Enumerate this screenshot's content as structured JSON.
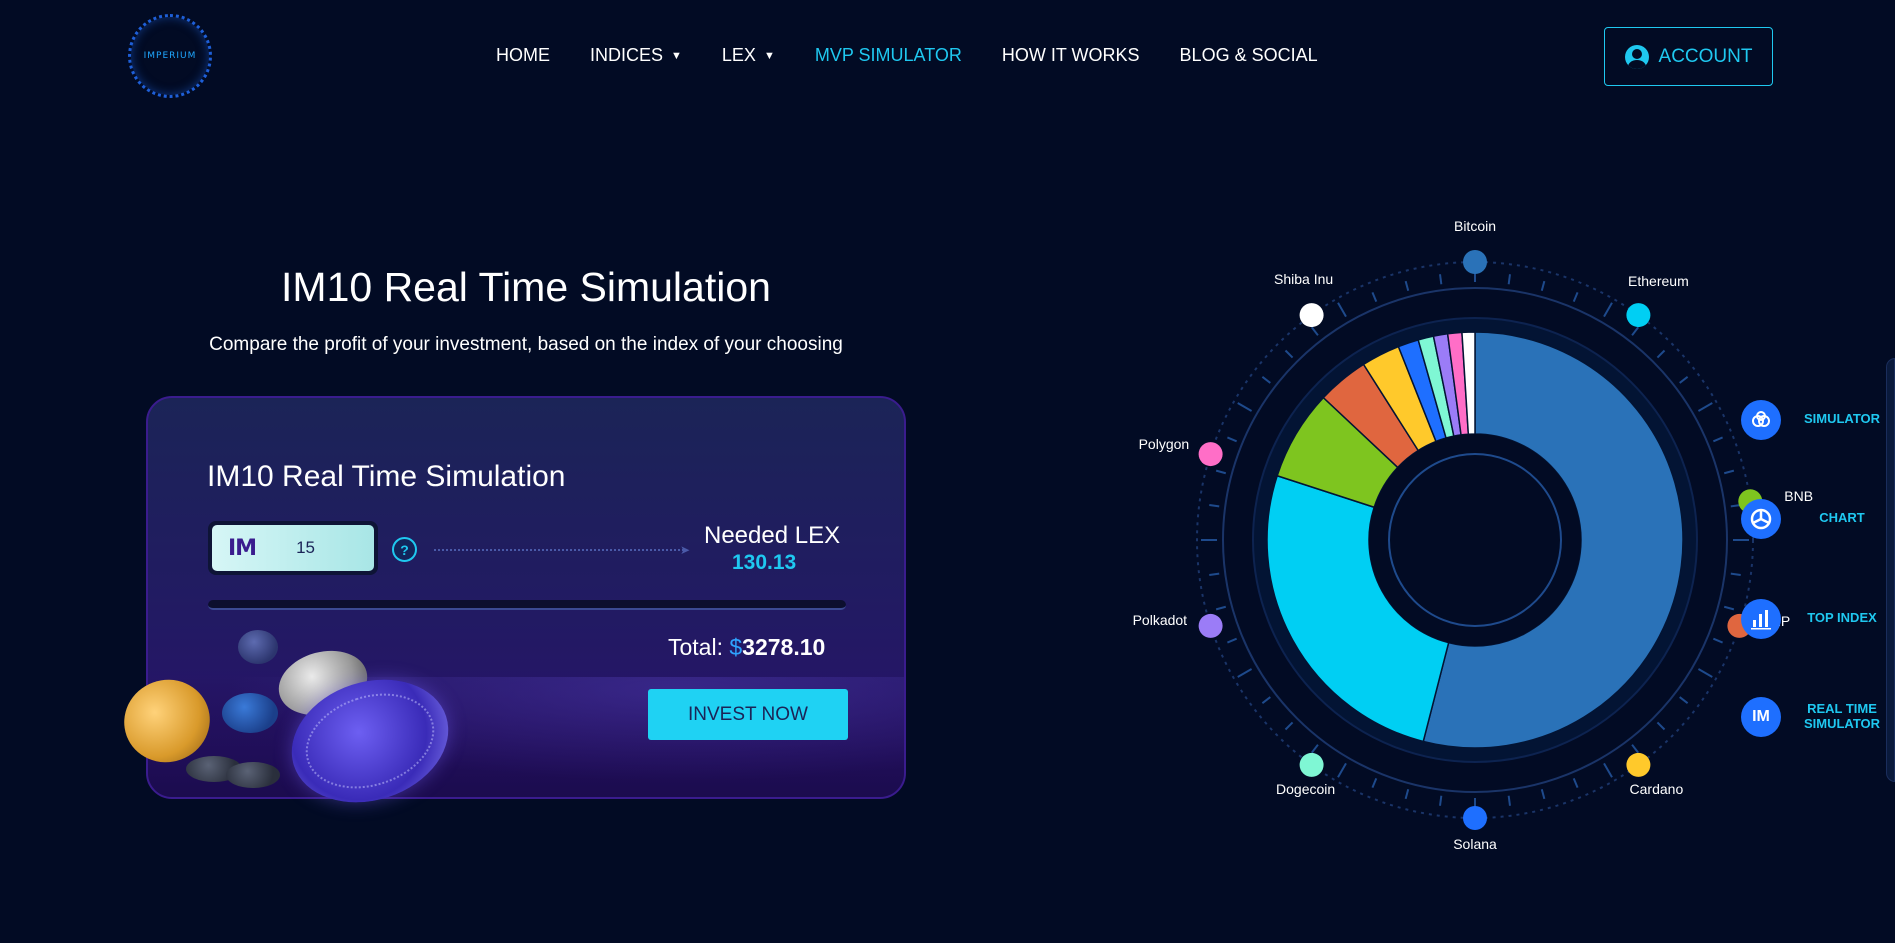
{
  "header": {
    "logo_text": "IMPERIUM",
    "nav": [
      {
        "label": "HOME",
        "dropdown": false,
        "active": false
      },
      {
        "label": "INDICES",
        "dropdown": true,
        "active": false
      },
      {
        "label": "LEX",
        "dropdown": true,
        "active": false
      },
      {
        "label": "MVP SIMULATOR",
        "dropdown": false,
        "active": true
      },
      {
        "label": "HOW IT WORKS",
        "dropdown": false,
        "active": false
      },
      {
        "label": "BLOG & SOCIAL",
        "dropdown": false,
        "active": false
      }
    ],
    "account_label": "ACCOUNT"
  },
  "hero": {
    "title": "IM10 Real Time Simulation",
    "subtitle": "Compare the profit of your investment, based on the index of your choosing"
  },
  "card": {
    "title": "IM10 Real Time Simulation",
    "input_logo": "IM",
    "input_value": "15",
    "help": "?",
    "needed_label": "Needed LEX",
    "needed_value": "130.13",
    "total_label": "Total:",
    "total_currency": "$",
    "total_value": "3278.10",
    "invest_label": "INVEST NOW"
  },
  "chart_data": {
    "type": "pie",
    "categories": [
      "Bitcoin",
      "Ethereum",
      "BNB",
      "XRP",
      "Cardano",
      "Solana",
      "Dogecoin",
      "Polkadot",
      "Polygon",
      "Shiba Inu"
    ],
    "values": [
      54,
      26,
      7,
      4,
      3,
      1.6,
      1.2,
      1.1,
      1.1,
      1.0
    ],
    "colors": [
      "#2a72b8",
      "#00cff3",
      "#7ec51f",
      "#e0663f",
      "#ffc92b",
      "#1e6fff",
      "#7ff7d4",
      "#9b7cf7",
      "#ff6ec7",
      "#ffffff"
    ],
    "dot_colors": {
      "Bitcoin": "#2a72b8",
      "Ethereum": "#00cff3",
      "BNB": "#7ec51f",
      "XRP": "#e0663f",
      "Cardano": "#ffc92b",
      "Solana": "#1e6fff",
      "Dogecoin": "#7ff7d4",
      "Polkadot": "#9b7cf7",
      "Polygon": "#ff6ec7",
      "Shiba Inu": "#ffffff"
    }
  },
  "side_panel": [
    {
      "label": "SIMULATOR",
      "icon": "simulator-icon"
    },
    {
      "label": "CHART",
      "icon": "chart-icon"
    },
    {
      "label": "TOP INDEX",
      "icon": "bar-chart-icon"
    },
    {
      "label": "REAL TIME SIMULATOR",
      "icon": "im-icon",
      "icon_text": "IM"
    }
  ]
}
